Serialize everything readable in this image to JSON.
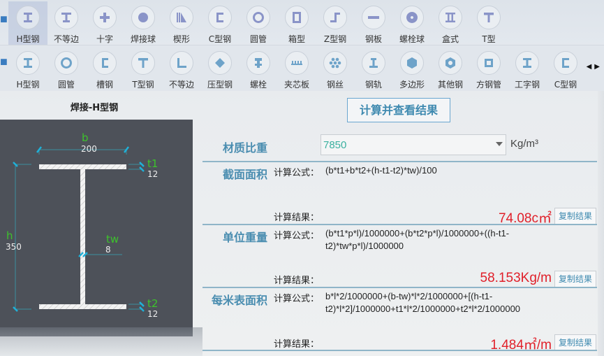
{
  "toolbar_row1": {
    "items": [
      {
        "label": "H型钢",
        "icon": "h-beam-icon",
        "active": true
      },
      {
        "label": "不等边",
        "icon": "unequal-beam-icon"
      },
      {
        "label": "十字",
        "icon": "cross-icon"
      },
      {
        "label": "焊接球",
        "icon": "welded-ball-icon"
      },
      {
        "label": "楔形",
        "icon": "wedge-icon"
      },
      {
        "label": "C型钢",
        "icon": "c-channel-icon"
      },
      {
        "label": "圆管",
        "icon": "round-tube-icon"
      },
      {
        "label": "箱型",
        "icon": "box-icon"
      },
      {
        "label": "Z型钢",
        "icon": "z-steel-icon"
      },
      {
        "label": "钢板",
        "icon": "steel-plate-icon"
      },
      {
        "label": "螺栓球",
        "icon": "bolt-ball-icon"
      },
      {
        "label": "盒式",
        "icon": "box-type-icon"
      },
      {
        "label": "T型",
        "icon": "t-shape-icon"
      }
    ]
  },
  "toolbar_row2": {
    "items": [
      {
        "label": "H型钢",
        "icon": "h-beam-icon"
      },
      {
        "label": "圆管",
        "icon": "round-tube-icon"
      },
      {
        "label": "槽钢",
        "icon": "channel-icon"
      },
      {
        "label": "T型钢",
        "icon": "t-steel-icon"
      },
      {
        "label": "不等边",
        "icon": "angle-icon"
      },
      {
        "label": "压型钢",
        "icon": "profiled-steel-icon"
      },
      {
        "label": "螺栓",
        "icon": "bolt-icon"
      },
      {
        "label": "夹芯板",
        "icon": "sandwich-panel-icon"
      },
      {
        "label": "钢丝",
        "icon": "steel-wire-icon"
      },
      {
        "label": "钢轨",
        "icon": "rail-icon"
      },
      {
        "label": "多边形",
        "icon": "polygon-icon"
      },
      {
        "label": "其他钢",
        "icon": "other-steel-icon"
      },
      {
        "label": "方钢管",
        "icon": "square-tube-icon"
      },
      {
        "label": "工字钢",
        "icon": "i-beam-icon"
      },
      {
        "label": "C型钢",
        "icon": "c-channel-icon"
      }
    ],
    "scroll_left": "◀",
    "scroll_right": "▶"
  },
  "diagram": {
    "title": "焊接-H型钢",
    "b_label": "b",
    "b_value": "200",
    "t1_label": "t1",
    "t1_value": "12",
    "h_label": "h",
    "h_value": "350",
    "tw_label": "tw",
    "tw_value": "8",
    "t2_label": "t2",
    "t2_value": "12"
  },
  "calc_button": "计算并查看结果",
  "density": {
    "label": "材质比重",
    "value": "7850",
    "unit": "Kg/m³"
  },
  "sections": [
    {
      "label": "截面面积",
      "formula_label": "计算公式：",
      "formula": "(b*t1+b*t2+(h-t1-t2)*tw)/100",
      "result_label": "计算结果：",
      "result": "74.08c㎡",
      "copy": "复制结果"
    },
    {
      "label": "单位重量",
      "formula_label": "计算公式：",
      "formula": "(b*t1*p*l)/1000000+(b*t2*p*l)/1000000+((h-t1-t2)*tw*p*l)/1000000",
      "result_label": "计算结果：",
      "result": "58.153Kg/m",
      "copy": "复制结果"
    },
    {
      "label": "每米表面积",
      "formula_label": "计算公式：",
      "formula": "b*l*2/1000000+(b-tw)*l*2/1000000+[(h-t1-t2)*l*2]/1000000+t1*l*2/1000000+t2*l*2/1000000",
      "result_label": "计算结果：",
      "result": "1.484㎡/m",
      "copy": "复制结果"
    }
  ]
}
